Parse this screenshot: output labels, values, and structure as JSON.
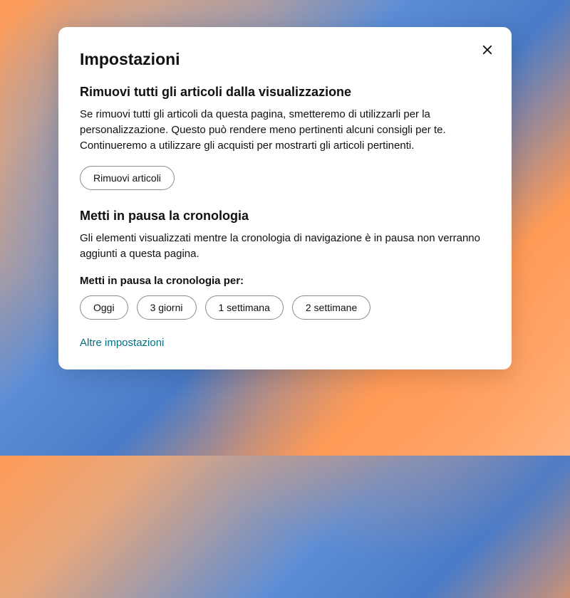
{
  "modal": {
    "title": "Impostazioni",
    "remove_section": {
      "heading": "Rimuovi tutti gli articoli dalla visualizzazione",
      "text": "Se rimuovi tutti gli articoli da questa pagina, smetteremo di utilizzarli per la personalizzazione. Questo può rendere meno pertinenti alcuni consigli per te. Continueremo a utilizzare gli acquisti per mostrarti gli articoli pertinenti.",
      "button_label": "Rimuovi articoli"
    },
    "pause_section": {
      "heading": "Metti in pausa la cronologia",
      "text": "Gli elementi visualizzati mentre la cronologia di navigazione è in pausa non verranno aggiunti a questa pagina.",
      "subheading": "Metti in pausa la cronologia per:",
      "options": [
        "Oggi",
        "3 giorni",
        "1 settimana",
        "2 settimane"
      ]
    },
    "more_link": "Altre impostazioni"
  }
}
